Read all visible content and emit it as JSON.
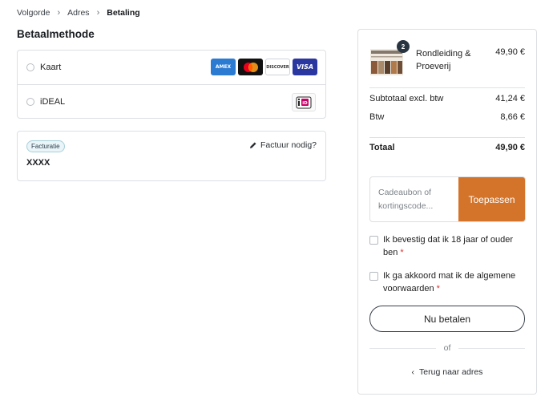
{
  "breadcrumb": {
    "items": [
      "Volgorde",
      "Adres",
      "Betaling"
    ],
    "separator": ">"
  },
  "payment": {
    "title": "Betaalmethode",
    "methods": [
      {
        "label": "Kaart",
        "icons": [
          "amex-icon",
          "mastercard-icon",
          "discover-icon",
          "visa-icon"
        ]
      },
      {
        "label": "iDEAL",
        "icons": [
          "ideal-icon"
        ]
      }
    ],
    "card_texts": {
      "amex": "AMEX",
      "discover": "DISCOVER",
      "visa": "VISA",
      "ideal": "iD"
    }
  },
  "invoice": {
    "badge": "Facturatie",
    "name": "XXXX",
    "link": "Factuur nodig?"
  },
  "summary": {
    "product": {
      "quantity": "2",
      "name": "Rondleiding & Proeverij",
      "price": "49,90 €"
    },
    "subtotal_label": "Subtotaal excl. btw",
    "subtotal_value": "41,24 €",
    "tax_label": "Btw",
    "tax_value": "8,66 €",
    "total_label": "Totaal",
    "total_value": "49,90 €",
    "coupon_placeholder": "Cadeaubon of kortingscode...",
    "apply_label": "Toepassen",
    "age_check": "Ik bevestig dat ik 18 jaar of ouder ben",
    "terms_check": "Ik ga akkoord mat ik de algemene voorwaarden",
    "required_mark": "*",
    "pay_button": "Nu betalen",
    "or_label": "of",
    "back_label": "Terug naar adres"
  },
  "colors": {
    "accent": "#d4742a",
    "badge_bg": "#e9f5f8",
    "border": "#dcdfe3"
  }
}
